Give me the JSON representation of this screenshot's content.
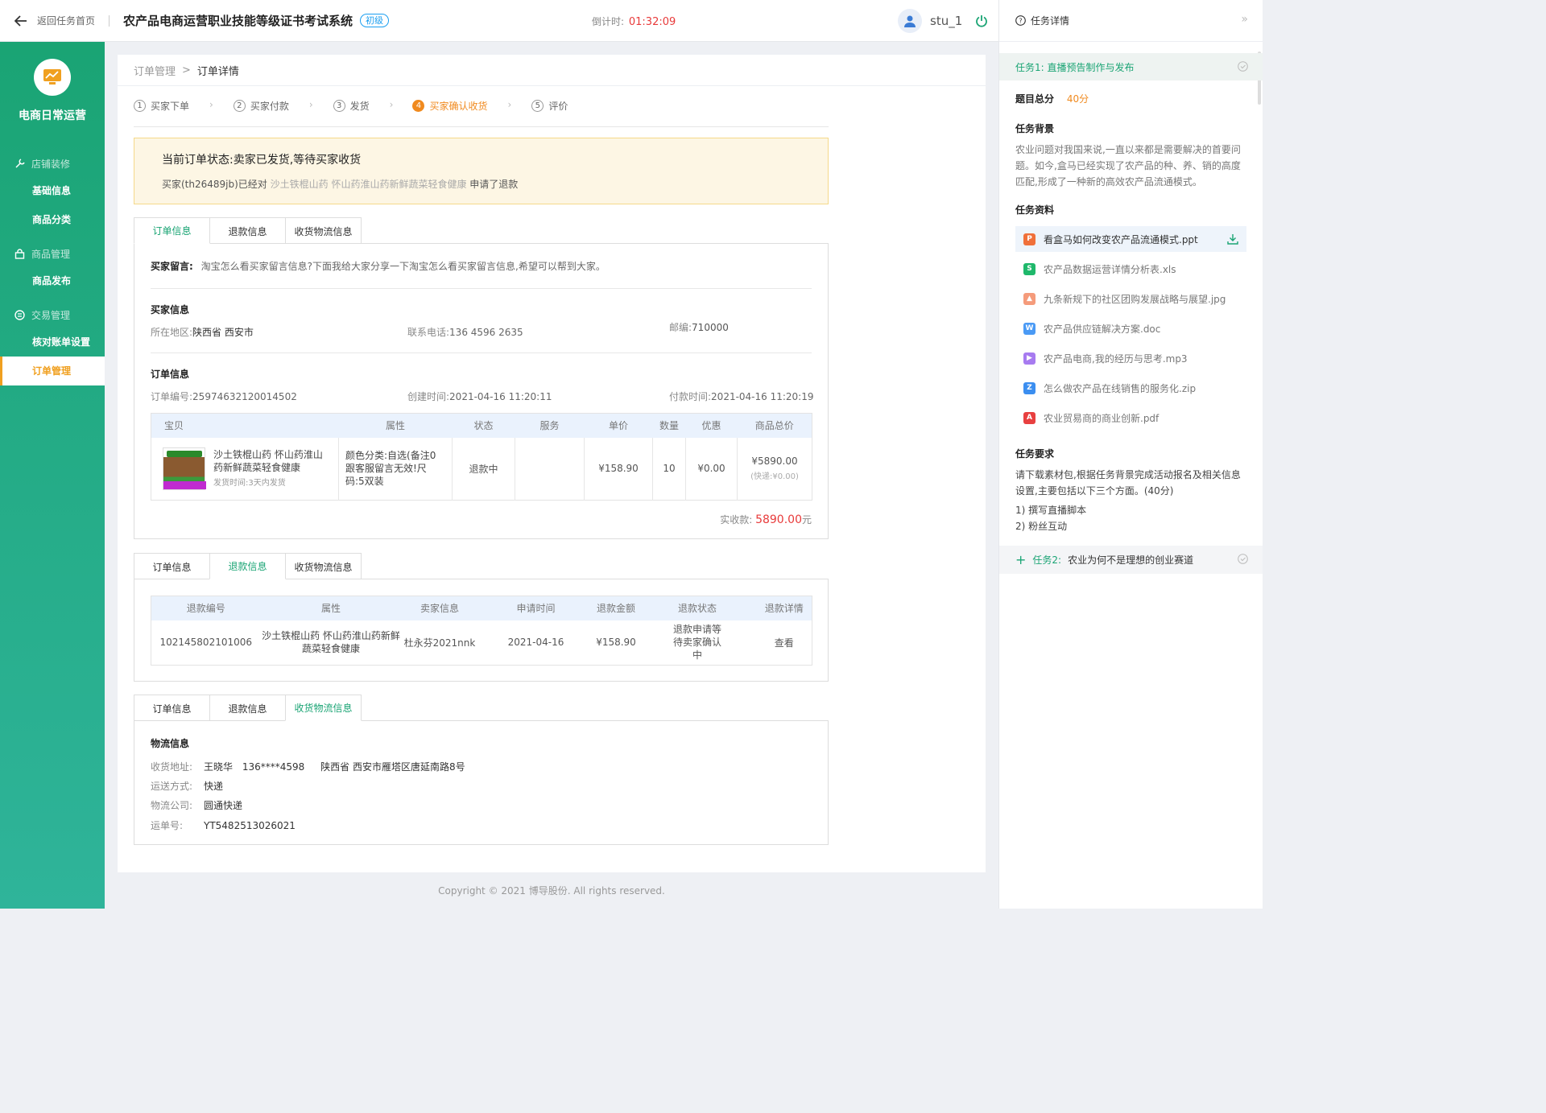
{
  "topbar": {
    "back_label": "返回任务首页",
    "system_title": "农产品电商运营职业技能等级证书考试系统",
    "level_badge": "初级",
    "countdown_label": "倒计时:",
    "countdown_value": "01:32:09",
    "username": "stu_1"
  },
  "sidebar": {
    "brand": "电商日常运营",
    "groups": [
      {
        "label": "店铺装修",
        "icon": "wrench-icon",
        "items": [
          "基础信息",
          "商品分类"
        ]
      },
      {
        "label": "商品管理",
        "icon": "bag-icon",
        "items": [
          "商品发布"
        ]
      },
      {
        "label": "交易管理",
        "icon": "transaction-icon",
        "items": [
          "核对账单设置",
          "订单管理"
        ]
      }
    ],
    "active_item": "订单管理"
  },
  "breadcrumb": {
    "parent": "订单管理",
    "sep": ">",
    "current": "订单详情"
  },
  "steps": [
    {
      "num": "1",
      "label": "买家下单"
    },
    {
      "num": "2",
      "label": "买家付款"
    },
    {
      "num": "3",
      "label": "发货"
    },
    {
      "num": "4",
      "label": "买家确认收货",
      "active": true
    },
    {
      "num": "5",
      "label": "评价"
    }
  ],
  "notice": {
    "title": "当前订单状态:卖家已发货,等待买家收货",
    "buyer_prefix": "买家(th26489jb)已经对",
    "product": "沙土铁棍山药 怀山药淮山药新鲜蔬菜轻食健康",
    "suffix": "申请了退款"
  },
  "tabs": [
    "订单信息",
    "退款信息",
    "收货物流信息"
  ],
  "order": {
    "message_label": "买家留言:",
    "message": "淘宝怎么看买家留言信息?下面我给大家分享一下淘宝怎么看买家留言信息,希望可以帮到大家。",
    "buyer_title": "买家信息",
    "region_label": "所在地区:",
    "region": "陕西省 西安市",
    "phone_label": "联系电话:",
    "phone": "136 4596 2635",
    "zip_label": "邮编:",
    "zip": "710000",
    "order_title": "订单信息",
    "no_label": "订单编号:",
    "no": "25974632120014502",
    "created_label": "创建时间:",
    "created": "2021-04-16 11:20:11",
    "paid_label": "付款时间:",
    "paid": "2021-04-16 11:20:19",
    "table_headers": [
      "宝贝",
      "属性",
      "状态",
      "服务",
      "单价",
      "数量",
      "优惠",
      "商品总价"
    ],
    "item": {
      "name": "沙土铁棍山药 怀山药淮山药新鲜蔬菜轻食健康",
      "ship_time": "发货时间:3天内发货",
      "attr": "颜色分类:自选(备注0跟客服留言无效!尺码:5双装",
      "status": "退款中",
      "service": "",
      "price": "¥158.90",
      "qty": "10",
      "discount": "¥0.00",
      "total": "¥5890.00",
      "shipping": "(快递:¥0.00)"
    },
    "received_label": "实收款:",
    "received_value": "5890.00",
    "received_unit": "元"
  },
  "refund": {
    "headers": [
      "退款编号",
      "属性",
      "卖家信息",
      "申请时间",
      "退款金额",
      "退款状态",
      "退款详情"
    ],
    "row": {
      "id": "102145802101006",
      "attr": "沙土铁棍山药 怀山药淮山药新鲜蔬菜轻食健康",
      "seller": "杜永芬2021nnk",
      "date": "2021-04-16",
      "amount": "¥158.90",
      "status": "退款申请等待卖家确认中",
      "detail": "查看"
    }
  },
  "logistics": {
    "title": "物流信息",
    "addr_label": "收货地址:",
    "addr_name": "王晓华",
    "addr_phone": "136****4598",
    "addr_detail": "陕西省 西安市雁塔区唐延南路8号",
    "method_label": "运送方式:",
    "method": "快递",
    "company_label": "物流公司:",
    "company": "圆通快递",
    "tracking_label": "运单号:",
    "tracking": "YT5482513026021"
  },
  "footer": "Copyright © 2021 博导股份. All rights reserved.",
  "right_panel": {
    "header": "任务详情",
    "task1": "任务1: 直播预告制作与发布",
    "score_label": "题目总分",
    "score": "40分",
    "bg_title": "任务背景",
    "bg_text": "农业问题对我国来说,一直以来都是需要解决的首要问题。如今,盒马已经实现了农产品的种、养、销的高度匹配,形成了一种新的高效农产品流通模式。",
    "res_title": "任务资料",
    "files": [
      {
        "name": "看盒马如何改变农产品流通模式.ppt",
        "color": "#f0703a",
        "glyph": "P"
      },
      {
        "name": "农产品数据运营详情分析表.xls",
        "color": "#1fb86b",
        "glyph": "S"
      },
      {
        "name": "九条新规下的社区团购发展战略与展望.jpg",
        "color": "#f59b7b",
        "glyph": "▲"
      },
      {
        "name": "农产品供应链解决方案.doc",
        "color": "#4a9af5",
        "glyph": "W"
      },
      {
        "name": "农产品电商,我的经历与思考.mp3",
        "color": "#a77bf0",
        "glyph": "▶"
      },
      {
        "name": "怎么做农产品在线销售的服务化.zip",
        "color": "#3b8ef0",
        "glyph": "Z"
      },
      {
        "name": "农业贸易商的商业创新.pdf",
        "color": "#e84040",
        "glyph": "A"
      }
    ],
    "req_title": "任务要求",
    "req_text": "请下载素材包,根据任务背景完成活动报名及相关信息设置,主要包括以下三个方面。(40分)",
    "req_items": [
      "1) 撰写直播脚本",
      "2) 粉丝互动"
    ],
    "task2_prefix": "任务2:",
    "task2": "农业为何不是理想的创业赛道"
  }
}
